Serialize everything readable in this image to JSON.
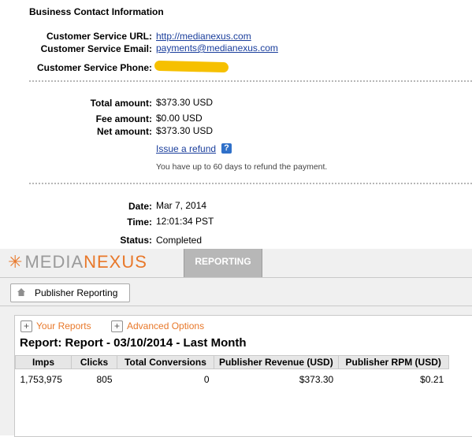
{
  "payment": {
    "section_title": "Business Contact Information",
    "cs_url_label": "Customer Service URL:",
    "cs_url": "http://medianexus.com",
    "cs_email_label": "Customer Service Email:",
    "cs_email": "payments@medianexus.com",
    "cs_phone_label": "Customer Service Phone:",
    "total_label": "Total amount:",
    "total": "$373.30 USD",
    "fee_label": "Fee amount:",
    "fee": "$0.00 USD",
    "net_label": "Net amount:",
    "net": "$373.30 USD",
    "refund_link": "Issue a refund",
    "refund_note": "You have up to 60 days to refund the payment.",
    "date_label": "Date:",
    "date": "Mar 7, 2014",
    "time_label": "Time:",
    "time": "12:01:34 PST",
    "status_label": "Status:",
    "status": "Completed"
  },
  "app": {
    "logo_media": "MEDIA",
    "logo_nexus": "NEXUS",
    "tab_reporting": "REPORTING",
    "publisher_button": "Publisher Reporting",
    "your_reports": "Your Reports",
    "advanced_options": "Advanced Options",
    "report_title": "Report: Report - 03/10/2014 - Last Month",
    "columns": [
      "Imps",
      "Clicks",
      "Total Conversions",
      "Publisher Revenue (USD)",
      "Publisher RPM (USD)"
    ],
    "rows": [
      [
        "1,753,975",
        "805",
        "0",
        "$373.30",
        "$0.21"
      ]
    ]
  },
  "colors": {
    "accent_orange": "#e8782a",
    "link_blue": "#1a3e9c",
    "redaction_yellow": "#f6c000"
  }
}
